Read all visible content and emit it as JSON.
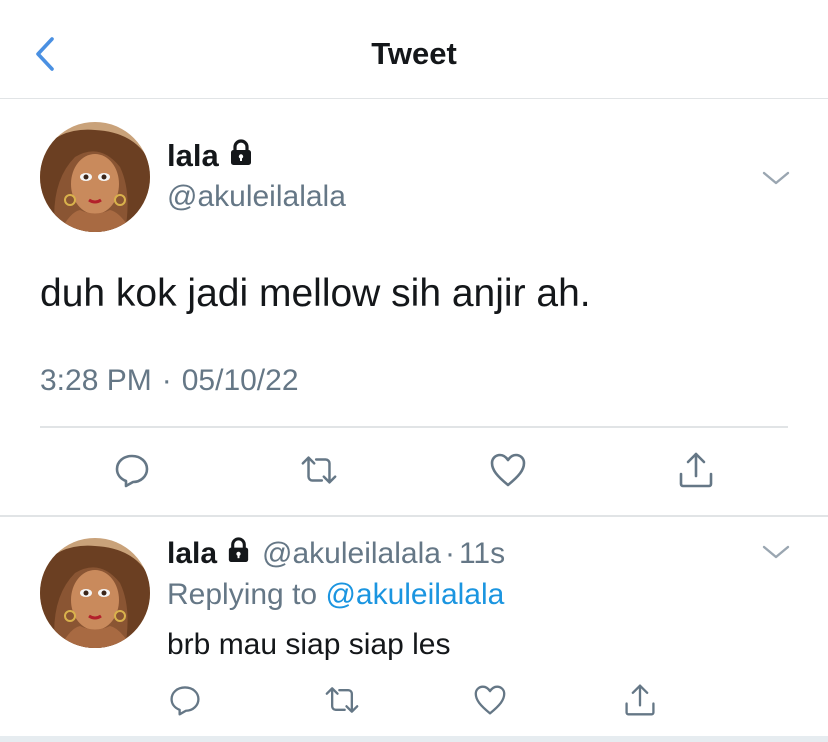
{
  "header": {
    "title": "Tweet",
    "back_icon": "chevron-left-icon"
  },
  "main_tweet": {
    "display_name": "lala",
    "handle": "@akuleilalala",
    "text": "duh kok jadi mellow sih anjir ah.",
    "time": "3:28 PM",
    "separator": "·",
    "date": "05/10/22",
    "actions": [
      "reply-icon",
      "retweet-icon",
      "like-icon",
      "share-icon"
    ]
  },
  "reply_tweet": {
    "display_name": "lala",
    "handle": "@akuleilalala",
    "dot": "·",
    "time_ago": "11s",
    "replying_prefix": "Replying to",
    "replying_to": "@akuleilalala",
    "text": "brb mau siap siap les",
    "actions": [
      "reply-icon",
      "retweet-icon",
      "like-icon",
      "share-icon"
    ]
  },
  "colors": {
    "accent": "#1b95e0",
    "back": "#4a90e2",
    "text": "#14171a",
    "secondary": "#657786",
    "divider": "#e1e4e6"
  }
}
